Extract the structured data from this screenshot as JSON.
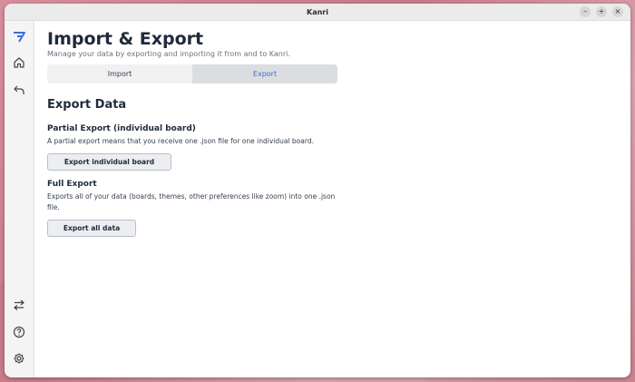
{
  "window": {
    "title": "Kanri",
    "minimize": "–",
    "maximize": "+",
    "close": "×"
  },
  "sidebar": {
    "logo": "kanri-logo-icon",
    "items": [
      {
        "icon": "home-icon"
      },
      {
        "icon": "back-arrow-icon"
      },
      {
        "icon": "import-export-icon"
      },
      {
        "icon": "help-icon"
      },
      {
        "icon": "settings-icon"
      }
    ]
  },
  "page": {
    "title": "Import & Export",
    "subtitle": "Manage your data by exporting and importing it from and to Kanri."
  },
  "tabs": [
    {
      "label": "Import",
      "active": false
    },
    {
      "label": "Export",
      "active": true
    }
  ],
  "export": {
    "section_title": "Export Data",
    "partial": {
      "title": "Partial Export (individual board)",
      "description": "A partial export means that you receive one .json file for one individual board.",
      "button": "Export individual board"
    },
    "full": {
      "title": "Full Export",
      "description": "Exports all of your data (boards, themes, other preferences like zoom) into one .json file.",
      "button": "Export all data"
    }
  },
  "colors": {
    "accent": "#3b6fd8",
    "heading": "#1f2a3a",
    "active_tab_bg": "#dcdde0"
  }
}
